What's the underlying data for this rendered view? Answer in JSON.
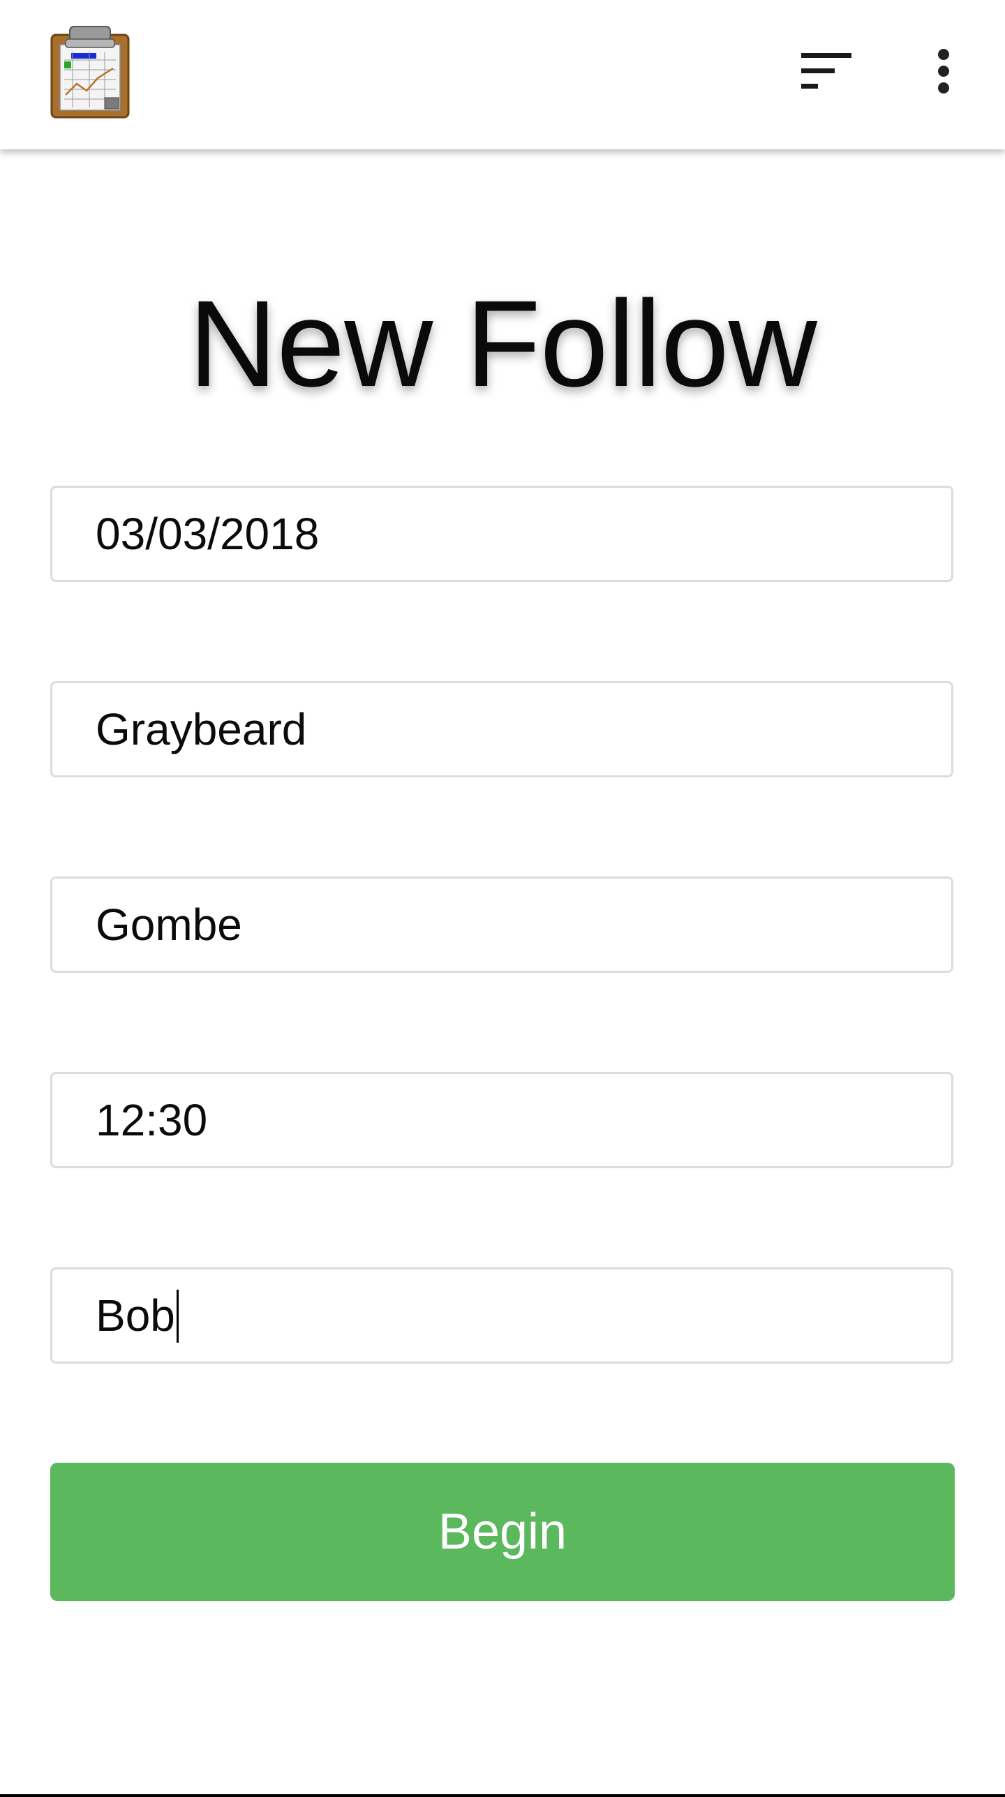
{
  "app": {
    "logo_icon": "clipboard-chart-icon",
    "sort_icon": "sort-icon",
    "more_icon": "more-vert-icon"
  },
  "page": {
    "title": "New Follow"
  },
  "form": {
    "date_value": "03/03/2018",
    "chimp_value": "Graybeard",
    "community_value": "Gombe",
    "time_value": "12:30",
    "observer_value": "Bob",
    "begin_label": "Begin"
  },
  "colors": {
    "button": "#5cb85c",
    "button_text": "#ffffff",
    "field_border": "#dcdcdc"
  }
}
